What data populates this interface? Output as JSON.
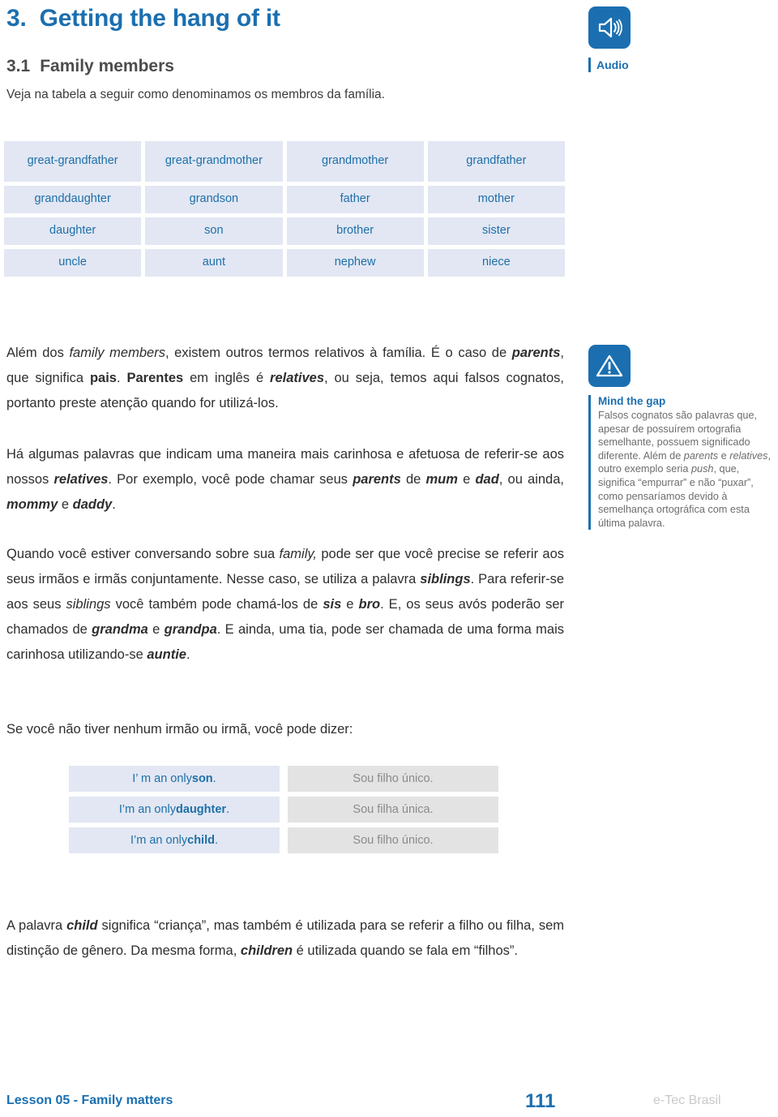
{
  "heading": {
    "number": "3.",
    "title": "Getting the hang of it",
    "sub_number": "3.1",
    "sub_title": "Family members",
    "lead": "Veja na tabela a seguir como denominamos os membros da família."
  },
  "audio": {
    "icon": "speaker-icon",
    "label": "Audio"
  },
  "family_table": {
    "rows": [
      [
        "great-grandfather",
        "great-grandmother",
        "grandmother",
        "grandfather"
      ],
      [
        "granddaughter",
        "grandson",
        "father",
        "mother"
      ],
      [
        "daughter",
        "son",
        "brother",
        "sister"
      ],
      [
        "uncle",
        "aunt",
        "nephew",
        "niece"
      ]
    ]
  },
  "paragraphs": {
    "p1_html": "Além dos <i>family members</i>, existem outros termos relativos à família. É o caso de <span class=\"bi\">parents</span>, que significa <b>pais</b>. <b>Parentes</b> em inglês é <span class=\"bi\">relatives</span>, ou seja, temos aqui falsos cognatos, portanto preste atenção quando for utilizá-los.",
    "p2_html": "Há algumas palavras que indicam uma maneira mais carinhosa e afetuosa de referir-se aos nossos <span class=\"bi\">relatives</span>. Por exemplo, você pode chamar seus <span class=\"bi\">parents</span> de <span class=\"bi\">mum</span> e <span class=\"bi\">dad</span>, ou ainda, <span class=\"bi\">mommy</span> e <span class=\"bi\">daddy</span>.",
    "p3_html": "Quando você estiver conversando sobre sua <i>family,</i> pode ser que você precise se referir aos seus irmãos e irmãs conjuntamente. Nesse caso, se utiliza a palavra <span class=\"bi\">siblings</span>. Para referir-se aos seus <i>siblings</i> você também pode chamá-los de <span class=\"bi\">sis</span> e <span class=\"bi\">bro</span>. E, os seus avós poderão ser chamados de <span class=\"bi\">grandma</span> e <span class=\"bi\">grandpa</span>. E ainda, uma tia, pode ser chamada de uma forma mais carinhosa utilizando-se <span class=\"bi\">auntie</span>.",
    "p4_html": "Se você não tiver nenhum irmão ou irmã, você pode dizer:",
    "p5_html": "A palavra <span class=\"bi\">child</span> significa “criança”, mas também é utilizada para se referir a filho ou filha, sem distinção de gênero. Da mesma forma, <span class=\"bi\">children</span> é utilizada quando se fala em “filhos”."
  },
  "mind_the_gap": {
    "icon": "warning-triangle-icon",
    "title": "Mind the gap",
    "body_html": "Falsos cognatos são palavras que, apesar de possuírem ortografia semelhante, possuem significado diferente. Além de <i>parents</i> e <i>relatives</i>, outro exemplo seria <i>push</i>, que, significa “empurrar” e não “puxar”, como pensaríamos devido à semelhança ortográfica com esta última palavra."
  },
  "sentence_table": {
    "rows": [
      {
        "en_html": "I’ m an only <b>son</b>.",
        "pt": "Sou filho único."
      },
      {
        "en_html": "I’m an only <b>daughter</b>.",
        "pt": "Sou filha única."
      },
      {
        "en_html": "I’m an only <b>child</b>.",
        "pt": "Sou filho único."
      }
    ]
  },
  "footer": {
    "left": "Lesson 05 - Family matters",
    "page": "111",
    "right": "e-Tec Brasil"
  },
  "colors": {
    "brand_blue": "#1b6fb0",
    "table_blue_bg": "#e2e7f3",
    "table_blue_text": "#1d6fa8",
    "table_gray_bg": "#e3e3e3",
    "table_gray_text": "#8a8a8a",
    "body_text": "#2e2e2e",
    "muted": "#6d6d6d"
  }
}
